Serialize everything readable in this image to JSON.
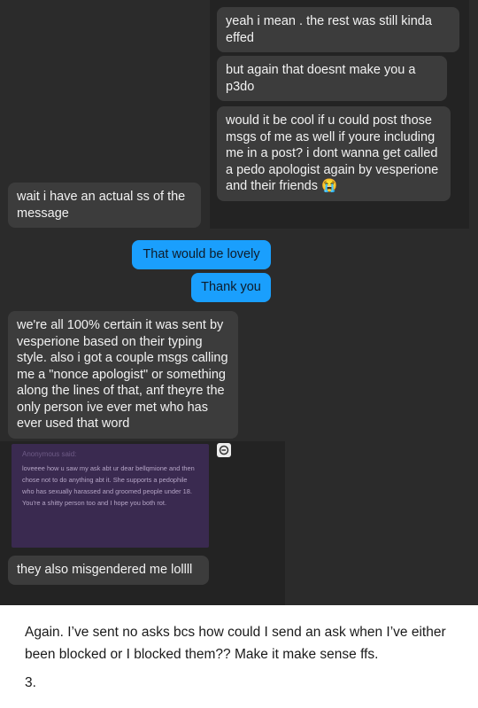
{
  "messages": [
    {
      "text": "yeah i mean . the rest was still kinda effed"
    },
    {
      "text": "but again that doesnt make you a p3do"
    },
    {
      "text": "would it be cool if u could post those msgs of me as well if youre including me in a post? i dont wanna get called a pedo apologist again by vesperione and their friends 😭"
    },
    {
      "text": "wait i have an actual ss of the message"
    },
    {
      "text": "That would be lovely"
    },
    {
      "text": "Thank you"
    },
    {
      "text": "we're all 100% certain it was sent by vesperione based on their typing style. also i got a couple msgs calling me a \"nonce apologist\" or something along the lines of that, anf theyre the only person ive ever met who has ever used that word"
    },
    {
      "text": "they also misgendered me lollll"
    }
  ],
  "ask": {
    "sender": "Anonymous said:",
    "text": "loveeee how u saw my ask abt ur dear bellqmione and then chose not to do anything abt it. She supports a pedophile who has sexually harassed and groomed people under 18. You're a shitty person too and I hope you both rot."
  },
  "caption": {
    "text": "Again. I’ve sent no asks bcs how could I send an ask when I’ve either been blocked or I blocked them?? Make it make sense ffs.",
    "number": "3."
  },
  "icons": [
    "reply-icon"
  ],
  "colors": {
    "background": "#2b2b2b",
    "panel": "#232323",
    "gray_bubble": "#3c3c3c",
    "blue_bubble": "#1a9ffd",
    "ask_card": "#3a2a50"
  }
}
